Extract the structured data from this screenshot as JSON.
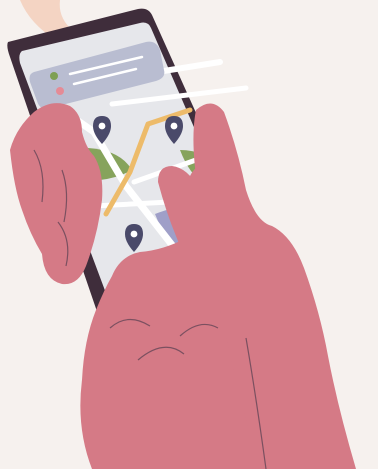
{
  "scene": {
    "subject": "hands-holding-phone-with-map",
    "colors": {
      "background": "#f6f1ee",
      "hand": "#d57a86",
      "hand_line": "#7b5060",
      "phone_body": "#3f2d3b",
      "screen": "#e6e7eb",
      "map_road": "#ffffff",
      "route": "#edbb6a",
      "park": "#86a35c",
      "lake": "#9f9fc8",
      "pin": "#4a4a6a",
      "card": "#b9bdd1",
      "card_line": "#ffffff",
      "dot_green": "#7ea053",
      "dot_pink": "#e58b96",
      "sleeve": "#f4d4c3"
    }
  }
}
